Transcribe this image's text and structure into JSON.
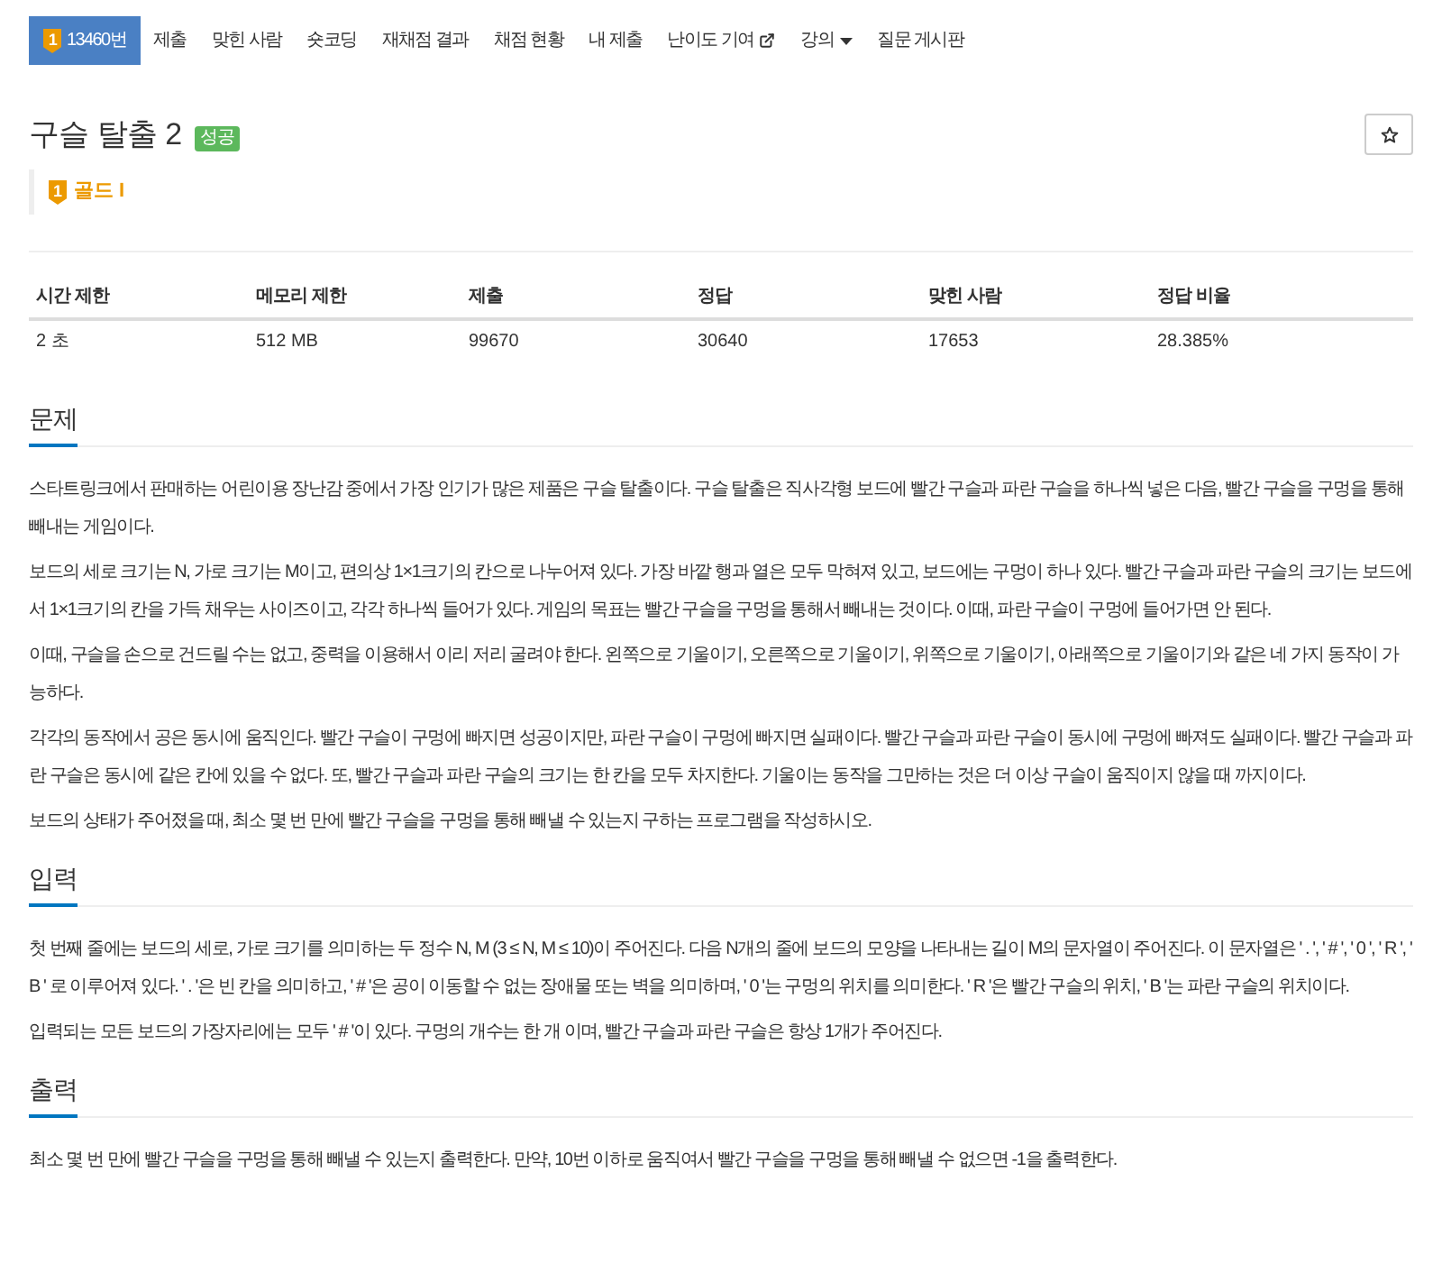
{
  "nav": {
    "tabs": [
      {
        "label": "13460번",
        "selected": true,
        "kind": "tiered",
        "badge": "1"
      },
      {
        "label": "제출",
        "selected": false,
        "kind": "plain"
      },
      {
        "label": "맞힌 사람",
        "selected": false,
        "kind": "plain"
      },
      {
        "label": "숏코딩",
        "selected": false,
        "kind": "plain"
      },
      {
        "label": "재채점 결과",
        "selected": false,
        "kind": "plain"
      },
      {
        "label": "채점 현황",
        "selected": false,
        "kind": "plain"
      },
      {
        "label": "내 제출",
        "selected": false,
        "kind": "plain"
      },
      {
        "label": "난이도 기여",
        "selected": false,
        "kind": "external"
      },
      {
        "label": "강의",
        "selected": false,
        "kind": "dropdown"
      },
      {
        "label": "질문 게시판",
        "selected": false,
        "kind": "plain"
      }
    ]
  },
  "problem": {
    "title": "구슬 탈출 2",
    "status": {
      "label": "성공",
      "kind": "success"
    },
    "tier": {
      "label": "골드 I",
      "badge": "1",
      "kind": "gold"
    }
  },
  "stats_table": {
    "columns": [
      "시간 제한",
      "메모리 제한",
      "제출",
      "정답",
      "맞힌 사람",
      "정답 비율"
    ],
    "rows": [
      [
        "2 초",
        "512 MB",
        "99670",
        "30640",
        "17653",
        "28.385%"
      ]
    ]
  },
  "sections": [
    {
      "heading": "문제",
      "paragraphs": [
        "스타트링크에서 판매하는 어린이용 장난감 중에서 가장 인기가 많은 제품은 구슬 탈출이다. 구슬 탈출은 직사각형 보드에 빨간 구슬과 파란 구슬을 하나씩 넣은 다음, 빨간 구슬을 구멍을 통해 빼내는 게임이다.",
        "보드의 세로 크기는 N, 가로 크기는 M이고, 편의상 1×1크기의 칸으로 나누어져 있다. 가장 바깥 행과 열은 모두 막혀져 있고, 보드에는 구멍이 하나 있다. 빨간 구슬과 파란 구슬의 크기는 보드에서 1×1크기의 칸을 가득 채우는 사이즈이고, 각각 하나씩 들어가 있다. 게임의 목표는 빨간 구슬을 구멍을 통해서 빼내는 것이다. 이때, 파란 구슬이 구멍에 들어가면 안 된다.",
        "이때, 구슬을 손으로 건드릴 수는 없고, 중력을 이용해서 이리 저리 굴려야 한다. 왼쪽으로 기울이기, 오른쪽으로 기울이기, 위쪽으로 기울이기, 아래쪽으로 기울이기와 같은 네 가지 동작이 가능하다.",
        "각각의 동작에서 공은 동시에 움직인다. 빨간 구슬이 구멍에 빠지면 성공이지만, 파란 구슬이 구멍에 빠지면 실패이다. 빨간 구슬과 파란 구슬이 동시에 구멍에 빠져도 실패이다. 빨간 구슬과 파란 구슬은 동시에 같은 칸에 있을 수 없다. 또, 빨간 구슬과 파란 구슬의 크기는 한 칸을 모두 차지한다. 기울이는 동작을 그만하는 것은 더 이상 구슬이 움직이지 않을 때 까지이다.",
        "보드의 상태가 주어졌을 때, 최소 몇 번 만에 빨간 구슬을 구멍을 통해 빼낼 수 있는지 구하는 프로그램을 작성하시오."
      ]
    },
    {
      "heading": "입력",
      "paragraphs": [
        "첫 번째 줄에는 보드의 세로, 가로 크기를 의미하는 두 정수 N, M (3 ≤ N, M ≤ 10)이 주어진다. 다음 N개의 줄에 보드의 모양을 나타내는 길이 M의 문자열이 주어진다. 이 문자열은 ' . ', ' # ', ' 0 ', ' R ', ' B ' 로 이루어져 있다. ' . '은 빈 칸을 의미하고, ' # '은 공이 이동할 수 없는 장애물 또는 벽을 의미하며, ' 0 '는 구멍의 위치를 의미한다. ' R '은 빨간 구슬의 위치, ' B '는 파란 구슬의 위치이다.",
        "입력되는 모든 보드의 가장자리에는 모두 ' # '이 있다. 구멍의 개수는 한 개 이며, 빨간 구슬과 파란 구슬은 항상 1개가 주어진다."
      ]
    },
    {
      "heading": "출력",
      "paragraphs": [
        "최소 몇 번 만에 빨간 구슬을 구멍을 통해 빼낼 수 있는지 출력한다. 만약, 10번 이하로 움직여서 빨간 구슬을 구멍을 통해 빼낼 수 없으면 -1을 출력한다."
      ]
    }
  ]
}
